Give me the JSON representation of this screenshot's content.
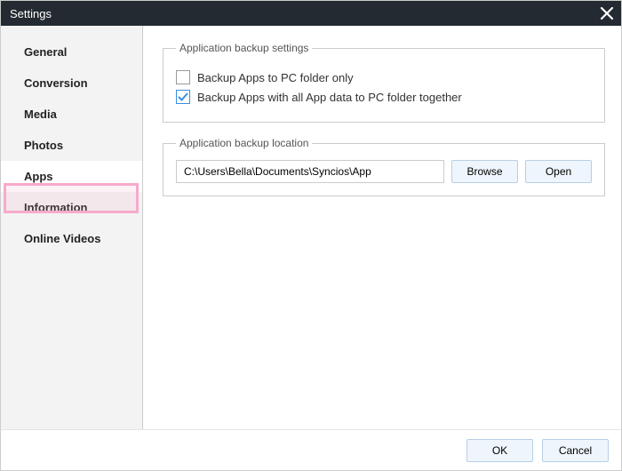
{
  "window": {
    "title": "Settings"
  },
  "sidebar": {
    "items": [
      {
        "label": "General"
      },
      {
        "label": "Conversion"
      },
      {
        "label": "Media"
      },
      {
        "label": "Photos"
      },
      {
        "label": "Apps"
      },
      {
        "label": "Information"
      },
      {
        "label": "Online Videos"
      }
    ],
    "selected_index": 4
  },
  "sections": {
    "backup_settings": {
      "legend": "Application backup settings",
      "option_folder_only": "Backup Apps to PC folder only",
      "option_with_data": "Backup Apps with all App data to PC folder together"
    },
    "backup_location": {
      "legend": "Application backup location",
      "path": "C:\\Users\\Bella\\Documents\\Syncios\\App",
      "browse": "Browse",
      "open": "Open"
    }
  },
  "footer": {
    "ok": "OK",
    "cancel": "Cancel"
  },
  "colors": {
    "accent": "#3a8fe0",
    "highlight": "#f7aacb",
    "titlebar": "#232a31"
  }
}
